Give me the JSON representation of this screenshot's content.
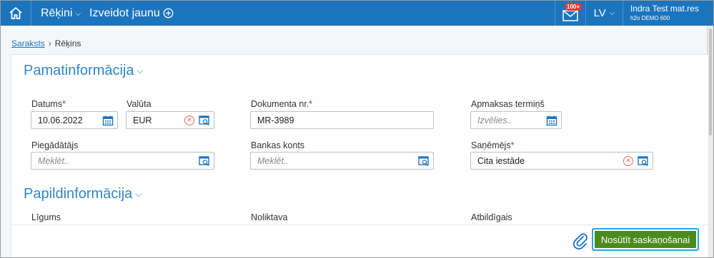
{
  "header": {
    "nav": {
      "invoices_label": "Rēķini",
      "create_label": "Izveidot jaunu"
    },
    "mail_badge": "100+",
    "language": "LV",
    "user": {
      "name": "Indra Test mat.res",
      "organization": "h2o DEMO 600"
    }
  },
  "breadcrumb": {
    "list_link": "Saraksts",
    "separator": "›",
    "current": "Rēķins"
  },
  "sections": {
    "basic": "Pamatinformācija",
    "extra": "Papildinformācija"
  },
  "fields": {
    "date": {
      "label": "Datums",
      "required": "*",
      "value": "10.06.2022"
    },
    "currency": {
      "label": "Valūta",
      "value": "EUR"
    },
    "doc_no": {
      "label": "Dokumenta nr.",
      "required": "*",
      "value": "MR-3989"
    },
    "payment_term": {
      "label": "Apmaksas termiņš",
      "placeholder": "Izvēlies.."
    },
    "supplier": {
      "label": "Piegādātājs",
      "placeholder": "Meklēt.."
    },
    "bank_account": {
      "label": "Bankas konts",
      "placeholder": "Meklēt.."
    },
    "recipient": {
      "label": "Saņēmējs",
      "required": "*",
      "value": "Cita iestāde"
    },
    "contract": {
      "label": "Līgums"
    },
    "warehouse": {
      "label": "Noliktava"
    },
    "responsible": {
      "label": "Atbildīgais"
    }
  },
  "footer": {
    "submit_label": "Nosūtīt saskaņošanai"
  },
  "colors": {
    "brand": "#1c74bd",
    "accent_link": "#2f86c9",
    "submit": "#4b8b1d",
    "required": "#d9232d"
  },
  "icons": [
    "home-icon",
    "chevron-down-icon",
    "plus-circle-icon",
    "mail-icon",
    "calendar-icon",
    "clear-icon",
    "search-list-icon",
    "paperclip-icon"
  ]
}
